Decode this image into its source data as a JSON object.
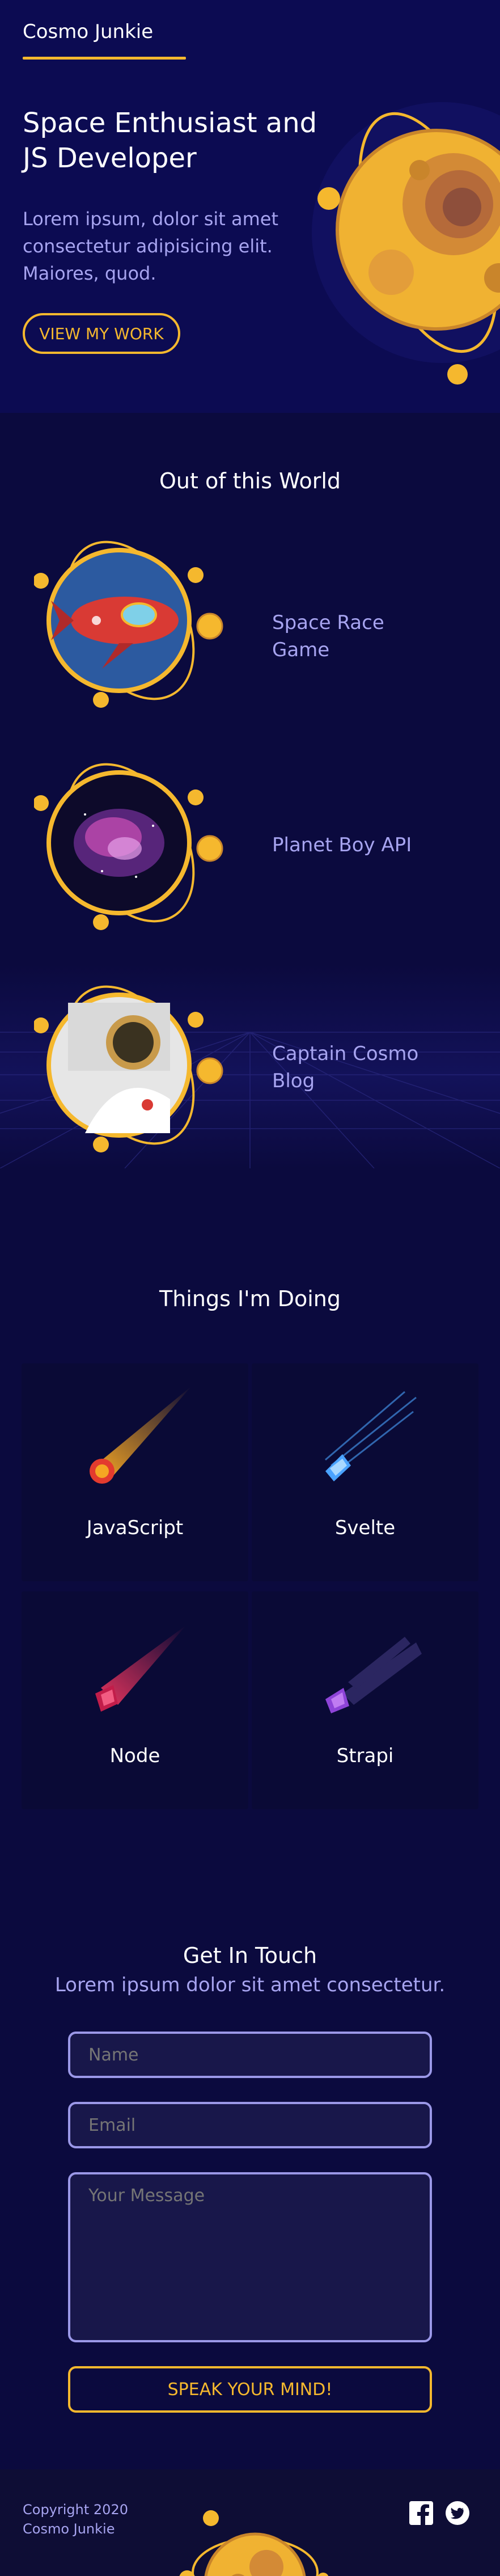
{
  "header": {
    "logo": "Cosmo Junkie"
  },
  "hero": {
    "title": "Space Enthusiast and JS Developer",
    "text": "Lorem ipsum, dolor sit amet consectetur adipisicing elit. Maiores, quod.",
    "button_label": "VIEW MY WORK"
  },
  "projects": {
    "title": "Out of this World",
    "items": [
      {
        "label": "Space Race Game",
        "image": "rocket-illustration"
      },
      {
        "label": "Planet Boy API",
        "image": "nebula-photo"
      },
      {
        "label": "Captain Cosmo Blog",
        "image": "astronaut-photo"
      }
    ]
  },
  "skills": {
    "title": "Things I'm Doing",
    "items": [
      {
        "label": "JavaScript",
        "icon": "orange-comet-icon",
        "color": "#f5a623"
      },
      {
        "label": "Svelte",
        "icon": "blue-comet-icon",
        "color": "#4aa3ff"
      },
      {
        "label": "Node",
        "icon": "red-comet-icon",
        "color": "#e2335c"
      },
      {
        "label": "Strapi",
        "icon": "purple-comet-icon",
        "color": "#8e44d8"
      }
    ]
  },
  "contact": {
    "title": "Get In Touch",
    "subtitle": "Lorem ipsum dolor sit amet consectetur.",
    "name_placeholder": "Name",
    "email_placeholder": "Email",
    "message_placeholder": "Your Message",
    "submit_label": "SPEAK YOUR MIND!"
  },
  "footer": {
    "copyright": "Copyright 2020",
    "name": "Cosmo Junkie",
    "social": [
      "facebook-icon",
      "twitter-icon"
    ]
  },
  "colors": {
    "accent": "#f5b82e",
    "text_muted": "#a7a4f0",
    "background": "#0b0a3e"
  }
}
